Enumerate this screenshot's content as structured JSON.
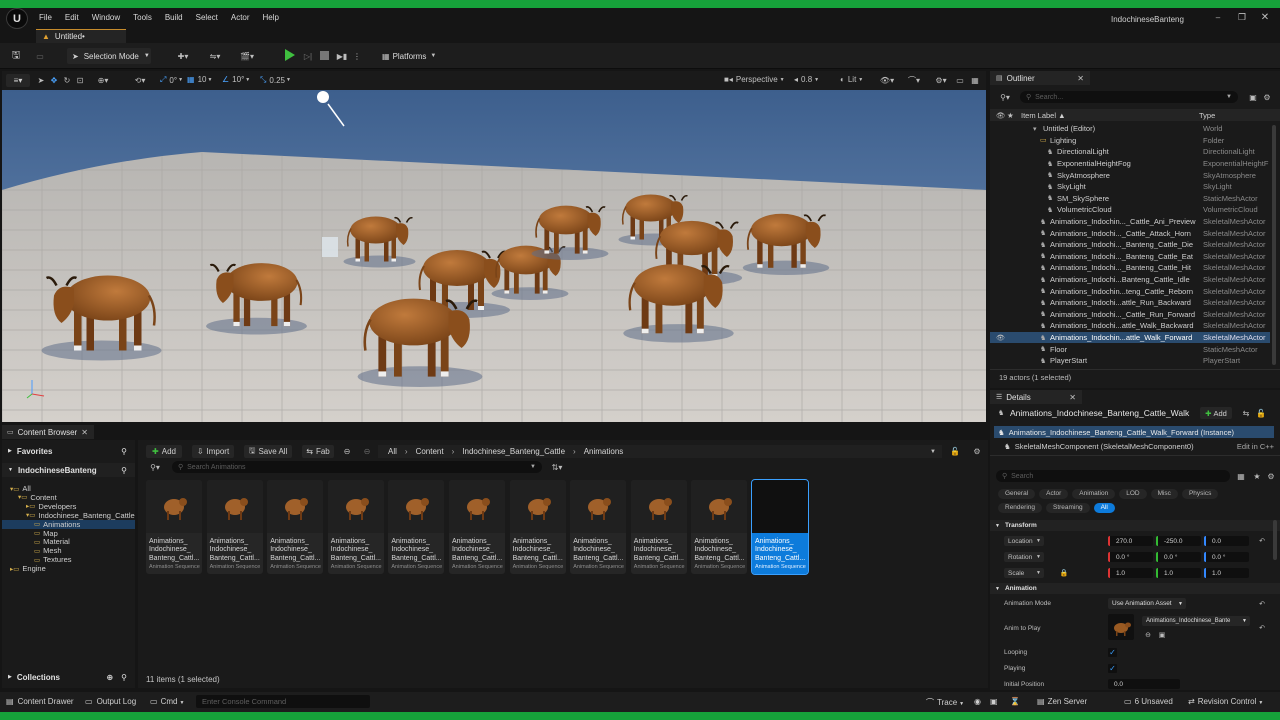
{
  "app": {
    "project_name": "IndochineseBanteng",
    "tab_title": "Untitled•"
  },
  "menu": [
    "File",
    "Edit",
    "Window",
    "Tools",
    "Build",
    "Select",
    "Actor",
    "Help"
  ],
  "toolbar": {
    "selection_mode": "Selection Mode",
    "platforms": "Platforms"
  },
  "viewport_toolbar": {
    "translate_snap": "0°",
    "grid": "10",
    "rotation_snap": "10°",
    "scale_snap": "0.25",
    "view": "Perspective",
    "camera_speed": "0.8",
    "view_mode": "Lit"
  },
  "outliner": {
    "title": "Outliner",
    "search_placeholder": "Search...",
    "col_label": "Item Label ▲",
    "col_type": "Type",
    "rows": [
      {
        "label": "Untitled (Editor)",
        "type": "World"
      },
      {
        "label": "Lighting",
        "type": "Folder"
      },
      {
        "label": "DirectionalLight",
        "type": "DirectionalLight"
      },
      {
        "label": "ExponentialHeightFog",
        "type": "ExponentialHeightF"
      },
      {
        "label": "SkyAtmosphere",
        "type": "SkyAtmosphere"
      },
      {
        "label": "SkyLight",
        "type": "SkyLight"
      },
      {
        "label": "SM_SkySphere",
        "type": "StaticMeshActor"
      },
      {
        "label": "VolumetricCloud",
        "type": "VolumetricCloud"
      },
      {
        "label": "Animations_Indochin..._Cattle_Ani_Preview",
        "type": "SkeletalMeshActor"
      },
      {
        "label": "Animations_Indochi..._Cattle_Attack_Horn",
        "type": "SkeletalMeshActor"
      },
      {
        "label": "Animations_Indochi..._Banteng_Cattle_Die",
        "type": "SkeletalMeshActor"
      },
      {
        "label": "Animations_Indochi..._Banteng_Cattle_Eat",
        "type": "SkeletalMeshActor"
      },
      {
        "label": "Animations_Indochi..._Banteng_Cattle_Hit",
        "type": "SkeletalMeshActor"
      },
      {
        "label": "Animations_Indochi...Banteng_Cattle_Idle",
        "type": "SkeletalMeshActor"
      },
      {
        "label": "Animations_Indochin...teng_Cattle_Reborn",
        "type": "SkeletalMeshActor"
      },
      {
        "label": "Animations_Indochi...attle_Run_Backward",
        "type": "SkeletalMeshActor"
      },
      {
        "label": "Animations_Indochi..._Cattle_Run_Forward",
        "type": "SkeletalMeshActor"
      },
      {
        "label": "Animations_Indochi...attle_Walk_Backward",
        "type": "SkeletalMeshActor"
      },
      {
        "label": "Animations_Indochin...attle_Walk_Forward",
        "type": "SkeletalMeshActor"
      },
      {
        "label": "Floor",
        "type": "StaticMeshActor"
      },
      {
        "label": "PlayerStart",
        "type": "PlayerStart"
      }
    ],
    "footer": "19 actors (1 selected)"
  },
  "details": {
    "title": "Details",
    "actor_name": "Animations_Indochinese_Banteng_Cattle_Walk",
    "add": "Add",
    "instance": "Animations_Indochinese_Banteng_Cattle_Walk_Forward (Instance)",
    "component": "SkeletalMeshComponent (SkeletalMeshComponent0)",
    "edit_cpp": "Edit in C++",
    "search_placeholder": "Search",
    "filters": [
      "General",
      "Actor",
      "Animation",
      "LOD",
      "Misc",
      "Physics",
      "Rendering",
      "Streaming",
      "All"
    ],
    "transform": {
      "title": "Transform",
      "location_label": "Location",
      "rotation_label": "Rotation",
      "scale_label": "Scale",
      "location": [
        "270.0",
        "-250.0",
        "0.0"
      ],
      "rotation": [
        "0.0 °",
        "0.0 °",
        "0.0 °"
      ],
      "scale": [
        "1.0",
        "1.0",
        "1.0"
      ]
    },
    "animation": {
      "title": "Animation",
      "mode_label": "Animation Mode",
      "mode_value": "Use Animation Asset",
      "anim_label": "Anim to Play",
      "anim_value": "Animations_Indochinese_Bante",
      "looping_label": "Looping",
      "playing_label": "Playing",
      "initial_label": "Initial Position",
      "initial_value": "0.0"
    }
  },
  "content_browser": {
    "tab": "Content Browser",
    "favorites": "Favorites",
    "project": "IndochineseBanteng",
    "tree": [
      "All",
      "Content",
      "Developers",
      "Indochinese_Banteng_Cattle",
      "Animations",
      "Map",
      "Material",
      "Mesh",
      "Textures",
      "Engine"
    ],
    "collections": "Collections",
    "add": "Add",
    "import": "Import",
    "save_all": "Save All",
    "fab": "Fab",
    "path": [
      "All",
      "Content",
      "Indochinese_Banteng_Cattle",
      "Animations"
    ],
    "search_placeholder": "Search Animations",
    "asset_name_lines": [
      "Animations_",
      "Indochinese_",
      "Banteng_Cattl..."
    ],
    "asset_type": "Animation Sequence",
    "asset_count": 11,
    "selected_index": 10,
    "footer": "11 items (1 selected)"
  },
  "statusbar": {
    "content_drawer": "Content Drawer",
    "output_log": "Output Log",
    "cmd": "Cmd",
    "console_placeholder": "Enter Console Command",
    "trace": "Trace",
    "zen": "Zen Server",
    "unsaved": "6 Unsaved",
    "revision": "Revision Control"
  },
  "colors": {
    "accent_green": "#16a23a",
    "selection_blue": "#0d7bdb",
    "play_green": "#3fbf3f"
  }
}
